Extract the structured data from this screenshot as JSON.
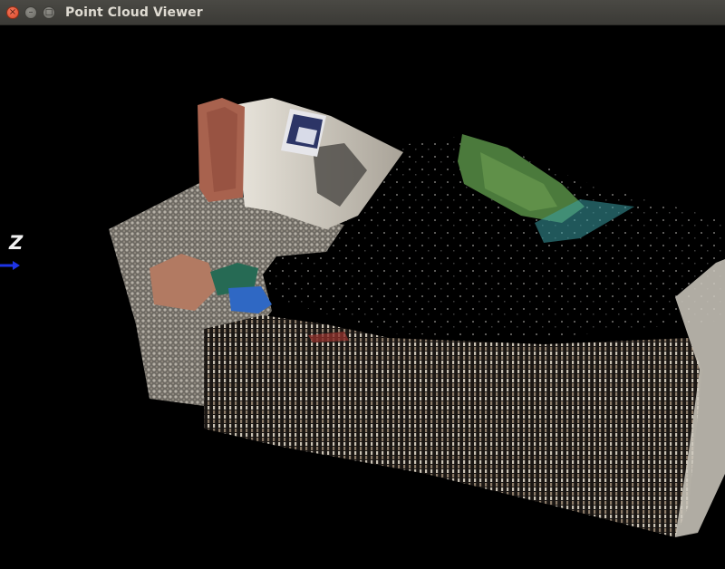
{
  "window": {
    "title": "Point Cloud Viewer",
    "controls": {
      "close_glyph": "×",
      "minimize_glyph": "–",
      "maximize_glyph": "□"
    }
  },
  "viewer": {
    "background_color": "#000000",
    "axis_label": "Z",
    "axis_color": "#1e34e6",
    "scene": {
      "wall_color": "#dcd8cf",
      "floor_color": "#8e8a84",
      "brick_color": "#a8624e",
      "foliage_color": "#4b7a3c",
      "poster_color": "#2c3566",
      "sign_color": "#2f68c4",
      "box_color": "#266a54",
      "water_color": "#3b9fa4"
    }
  }
}
